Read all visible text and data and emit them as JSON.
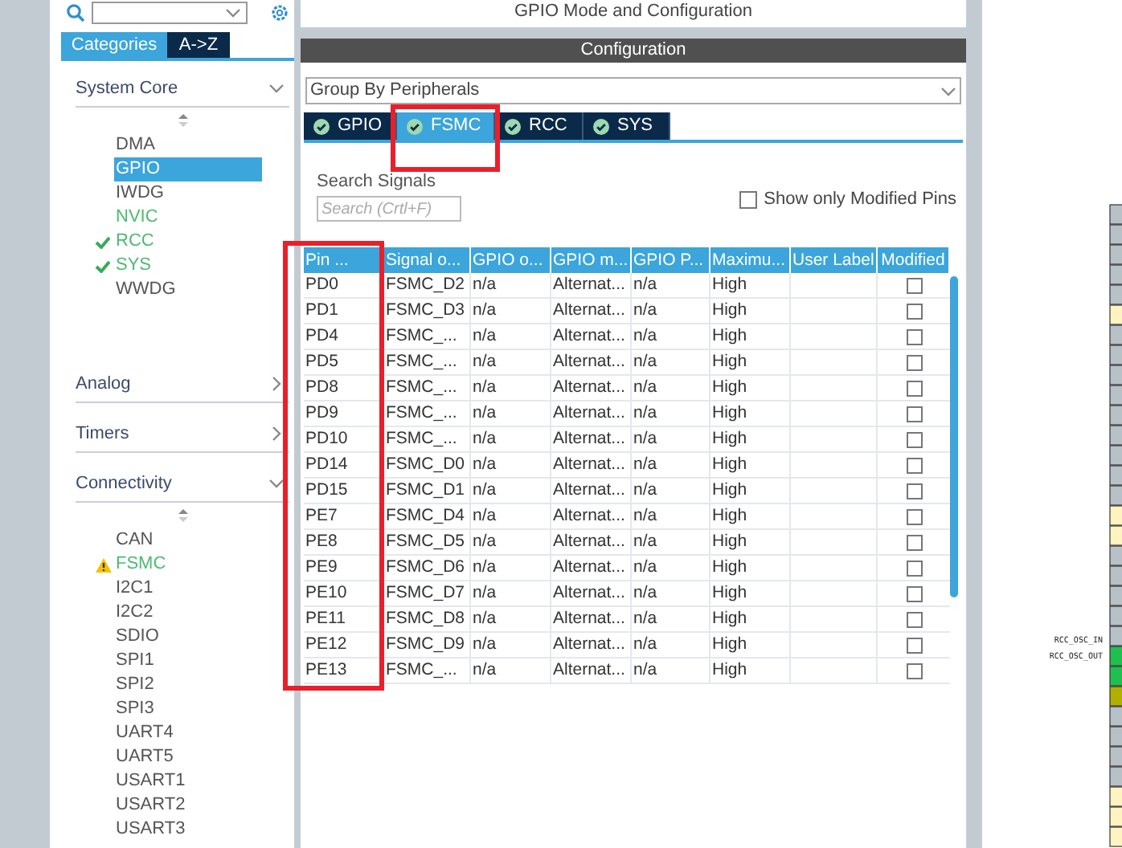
{
  "sidebar": {
    "tabs": [
      {
        "label": "Categories",
        "selected": true
      },
      {
        "label": "A->Z",
        "selected": false
      }
    ],
    "sections": [
      {
        "title": "System Core",
        "expanded": true,
        "items": [
          {
            "label": "DMA",
            "selected": false,
            "configured": false,
            "kind": "plain"
          },
          {
            "label": "GPIO",
            "selected": true,
            "configured": false,
            "kind": "plain"
          },
          {
            "label": "IWDG",
            "selected": false,
            "configured": false,
            "kind": "plain"
          },
          {
            "label": "NVIC",
            "selected": false,
            "configured": true,
            "kind": "plain"
          },
          {
            "label": "RCC",
            "selected": false,
            "configured": true,
            "kind": "check"
          },
          {
            "label": "SYS",
            "selected": false,
            "configured": true,
            "kind": "check"
          },
          {
            "label": "WWDG",
            "selected": false,
            "configured": false,
            "kind": "plain"
          }
        ]
      },
      {
        "title": "Analog",
        "expanded": false
      },
      {
        "title": "Timers",
        "expanded": false
      },
      {
        "title": "Connectivity",
        "expanded": true,
        "items": [
          {
            "label": "CAN",
            "selected": false,
            "configured": false,
            "kind": "plain"
          },
          {
            "label": "FSMC",
            "selected": false,
            "configured": true,
            "kind": "warning"
          },
          {
            "label": "I2C1",
            "selected": false,
            "configured": false,
            "kind": "plain"
          },
          {
            "label": "I2C2",
            "selected": false,
            "configured": false,
            "kind": "plain"
          },
          {
            "label": "SDIO",
            "selected": false,
            "configured": false,
            "kind": "plain"
          },
          {
            "label": "SPI1",
            "selected": false,
            "configured": false,
            "kind": "plain"
          },
          {
            "label": "SPI2",
            "selected": false,
            "configured": false,
            "kind": "plain"
          },
          {
            "label": "SPI3",
            "selected": false,
            "configured": false,
            "kind": "plain"
          },
          {
            "label": "UART4",
            "selected": false,
            "configured": false,
            "kind": "plain"
          },
          {
            "label": "UART5",
            "selected": false,
            "configured": false,
            "kind": "plain"
          },
          {
            "label": "USART1",
            "selected": false,
            "configured": false,
            "kind": "plain"
          },
          {
            "label": "USART2",
            "selected": false,
            "configured": false,
            "kind": "plain"
          },
          {
            "label": "USART3",
            "selected": false,
            "configured": false,
            "kind": "plain"
          }
        ]
      }
    ]
  },
  "panel": {
    "title": "GPIO Mode and Configuration",
    "header": "Configuration",
    "group_by": "Group By Peripherals",
    "tabs": [
      {
        "label": "GPIO",
        "selected": false
      },
      {
        "label": "FSMC",
        "selected": true
      },
      {
        "label": "RCC",
        "selected": false
      },
      {
        "label": "SYS",
        "selected": false
      }
    ],
    "search_label": "Search Signals",
    "search": {
      "placeholder": "Search (Crtl+F)"
    },
    "modified_only": {
      "label": "Show only Modified Pins",
      "checked": false
    },
    "table": {
      "columns": [
        "Pin ...",
        "Signal o...",
        "GPIO o...",
        "GPIO m...",
        "GPIO P...",
        "Maximu...",
        "User Label",
        "Modified"
      ],
      "rows": [
        {
          "pin": "PD0",
          "signal": "FSMC_D2",
          "output": "n/a",
          "mode": "Alternat...",
          "pull": "n/a",
          "speed": "High",
          "modified": false
        },
        {
          "pin": "PD1",
          "signal": "FSMC_D3",
          "output": "n/a",
          "mode": "Alternat...",
          "pull": "n/a",
          "speed": "High",
          "modified": false
        },
        {
          "pin": "PD4",
          "signal": "FSMC_...",
          "output": "n/a",
          "mode": "Alternat...",
          "pull": "n/a",
          "speed": "High",
          "modified": false
        },
        {
          "pin": "PD5",
          "signal": "FSMC_...",
          "output": "n/a",
          "mode": "Alternat...",
          "pull": "n/a",
          "speed": "High",
          "modified": false
        },
        {
          "pin": "PD8",
          "signal": "FSMC_...",
          "output": "n/a",
          "mode": "Alternat...",
          "pull": "n/a",
          "speed": "High",
          "modified": false
        },
        {
          "pin": "PD9",
          "signal": "FSMC_...",
          "output": "n/a",
          "mode": "Alternat...",
          "pull": "n/a",
          "speed": "High",
          "modified": false
        },
        {
          "pin": "PD10",
          "signal": "FSMC_...",
          "output": "n/a",
          "mode": "Alternat...",
          "pull": "n/a",
          "speed": "High",
          "modified": false
        },
        {
          "pin": "PD14",
          "signal": "FSMC_D0",
          "output": "n/a",
          "mode": "Alternat...",
          "pull": "n/a",
          "speed": "High",
          "modified": false
        },
        {
          "pin": "PD15",
          "signal": "FSMC_D1",
          "output": "n/a",
          "mode": "Alternat...",
          "pull": "n/a",
          "speed": "High",
          "modified": false
        },
        {
          "pin": "PE7",
          "signal": "FSMC_D4",
          "output": "n/a",
          "mode": "Alternat...",
          "pull": "n/a",
          "speed": "High",
          "modified": false
        },
        {
          "pin": "PE8",
          "signal": "FSMC_D5",
          "output": "n/a",
          "mode": "Alternat...",
          "pull": "n/a",
          "speed": "High",
          "modified": false
        },
        {
          "pin": "PE9",
          "signal": "FSMC_D6",
          "output": "n/a",
          "mode": "Alternat...",
          "pull": "n/a",
          "speed": "High",
          "modified": false
        },
        {
          "pin": "PE10",
          "signal": "FSMC_D7",
          "output": "n/a",
          "mode": "Alternat...",
          "pull": "n/a",
          "speed": "High",
          "modified": false
        },
        {
          "pin": "PE11",
          "signal": "FSMC_D8",
          "output": "n/a",
          "mode": "Alternat...",
          "pull": "n/a",
          "speed": "High",
          "modified": false
        },
        {
          "pin": "PE12",
          "signal": "FSMC_D9",
          "output": "n/a",
          "mode": "Alternat...",
          "pull": "n/a",
          "speed": "High",
          "modified": false
        },
        {
          "pin": "PE13",
          "signal": "FSMC_...",
          "output": "n/a",
          "mode": "Alternat...",
          "pull": "n/a",
          "speed": "High",
          "modified": false
        }
      ]
    }
  },
  "chip_view": {
    "pin_labels": [
      "RCC_OSC_IN",
      "RCC_OSC_OUT"
    ]
  }
}
